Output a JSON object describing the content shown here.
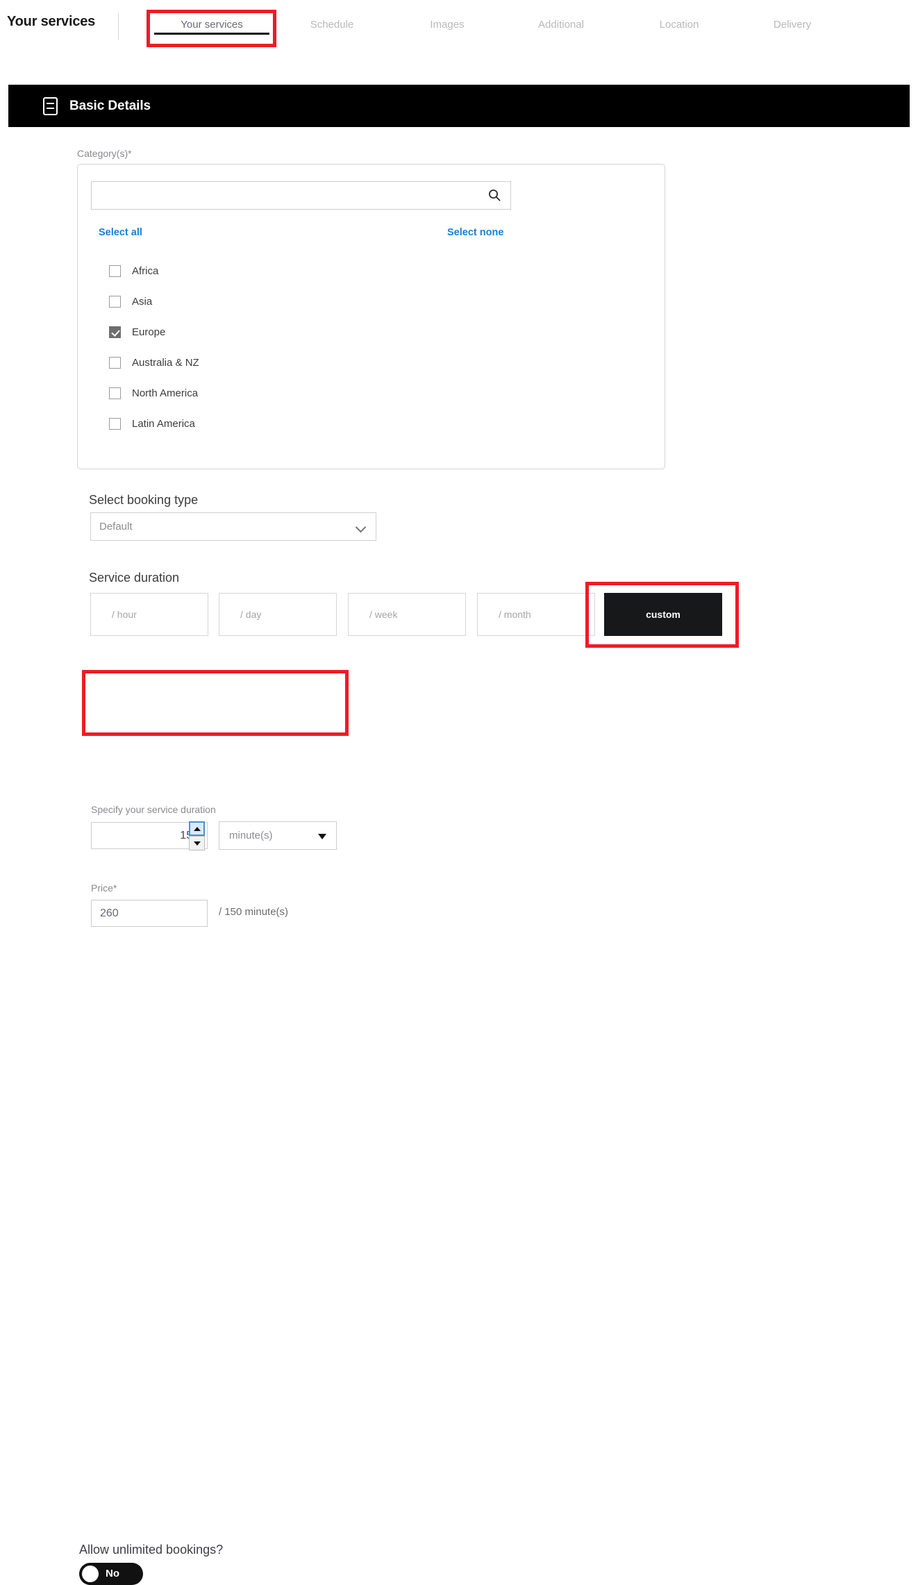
{
  "header": {
    "page_title": "Your services",
    "tabs": [
      {
        "label": "Your services",
        "active": true
      },
      {
        "label": "Schedule",
        "active": false
      },
      {
        "label": "Images",
        "active": false
      },
      {
        "label": "Additional",
        "active": false
      },
      {
        "label": "Location",
        "active": false
      },
      {
        "label": "Delivery",
        "active": false
      }
    ]
  },
  "section": {
    "title": "Basic Details",
    "icon": "document-icon"
  },
  "categories": {
    "label": "Category(s)*",
    "search_placeholder": "",
    "search_value": "",
    "search_icon": "search-icon",
    "select_all_label": "Select all",
    "select_none_label": "Select none",
    "items": [
      {
        "label": "Africa",
        "checked": false
      },
      {
        "label": "Asia",
        "checked": false
      },
      {
        "label": "Europe",
        "checked": true
      },
      {
        "label": "Australia & NZ",
        "checked": false
      },
      {
        "label": "North America",
        "checked": false
      },
      {
        "label": "Latin America",
        "checked": false
      }
    ]
  },
  "booking_type": {
    "title": "Select booking type",
    "selected": "Default",
    "chevron_icon": "chevron-down-icon"
  },
  "service_duration": {
    "title": "Service duration",
    "options": [
      {
        "label": "/ hour",
        "selected": false
      },
      {
        "label": "/ day",
        "selected": false
      },
      {
        "label": "/ week",
        "selected": false
      },
      {
        "label": "/ month",
        "selected": false
      },
      {
        "label": "custom",
        "selected": true
      }
    ]
  },
  "specify_duration": {
    "label": "Specify your service duration",
    "value": "150",
    "unit": "minute(s)",
    "spinner_up_icon": "arrow-up-icon",
    "spinner_down_icon": "arrow-down-icon",
    "unit_caret_icon": "caret-down-icon"
  },
  "price": {
    "label": "Price*",
    "value": "260",
    "suffix": "/ 150 minute(s)"
  },
  "unlimited_bookings": {
    "label": "Allow unlimited bookings?",
    "state": "No"
  },
  "colors": {
    "annotation": "#ee1c25",
    "accent_link": "#1b7fd4",
    "header_bg": "#000000",
    "selected_option_bg": "#17181a"
  }
}
